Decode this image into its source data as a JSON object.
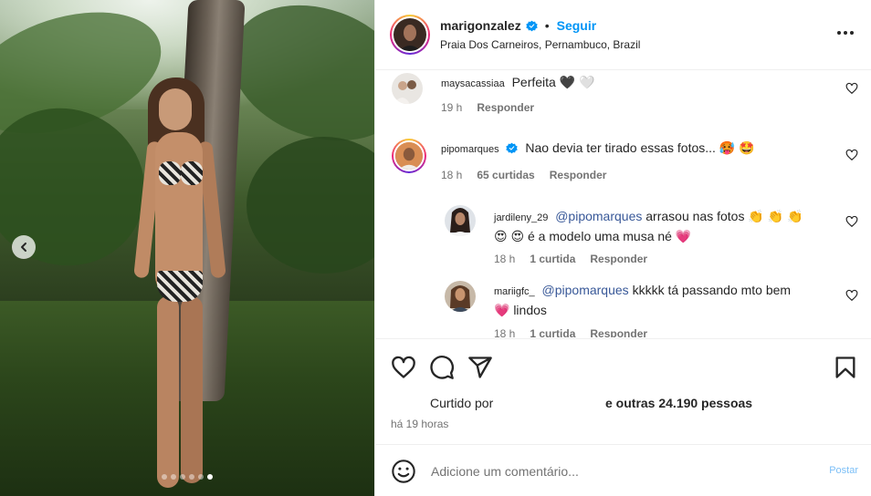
{
  "post": {
    "author": "marigonzalez",
    "follow_label": "Seguir",
    "separator": "•",
    "location": "Praia Dos Carneiros, Pernambuco, Brazil",
    "carousel": {
      "current_index": 6,
      "total": 6
    }
  },
  "comments": [
    {
      "user": "maysacassiaa",
      "text": "Perfeita 🖤 🤍",
      "time": "19 h",
      "likes": "",
      "reply_label": "Responder"
    },
    {
      "user": "pipomarques",
      "verified": true,
      "text": "Nao devia ter tirado essas fotos... 🥵 🤩",
      "time": "18 h",
      "likes": "65 curtidas",
      "reply_label": "Responder"
    },
    {
      "user": "jardileny_29",
      "mention": "@pipomarques",
      "text_line1": "arrasou nas fotos 👏 👏 👏",
      "text_line2": "😍 😍  é a modelo uma musa né 💗",
      "time": "18 h",
      "likes": "1 curtida",
      "reply_label": "Responder"
    },
    {
      "user": "mariigfc_",
      "mention": "@pipomarques",
      "text_line1": "kkkkk tá passando mto bem",
      "text_line2": "💗  lindos",
      "time": "18 h",
      "likes": "1 curtida",
      "reply_label": "Responder"
    }
  ],
  "likes": {
    "prefix": "Curtido por",
    "suffix_bold": "e outras 24.190 pessoas"
  },
  "time_ago": "há 19 horas",
  "compose": {
    "placeholder": "Adicione um comentário...",
    "post_label": "Postar"
  },
  "colors": {
    "link_blue": "#0095f6",
    "mention_blue": "#385898",
    "secondary_text": "#737373",
    "post_disabled": "#7bbff7"
  },
  "icons": {
    "more": "more-horizontal-icon",
    "like": "heart-icon",
    "comment": "comment-icon",
    "share": "share-icon",
    "save": "bookmark-icon",
    "emoji": "emoji-icon",
    "prev": "chevron-left-icon",
    "verified": "verified-badge-icon"
  }
}
